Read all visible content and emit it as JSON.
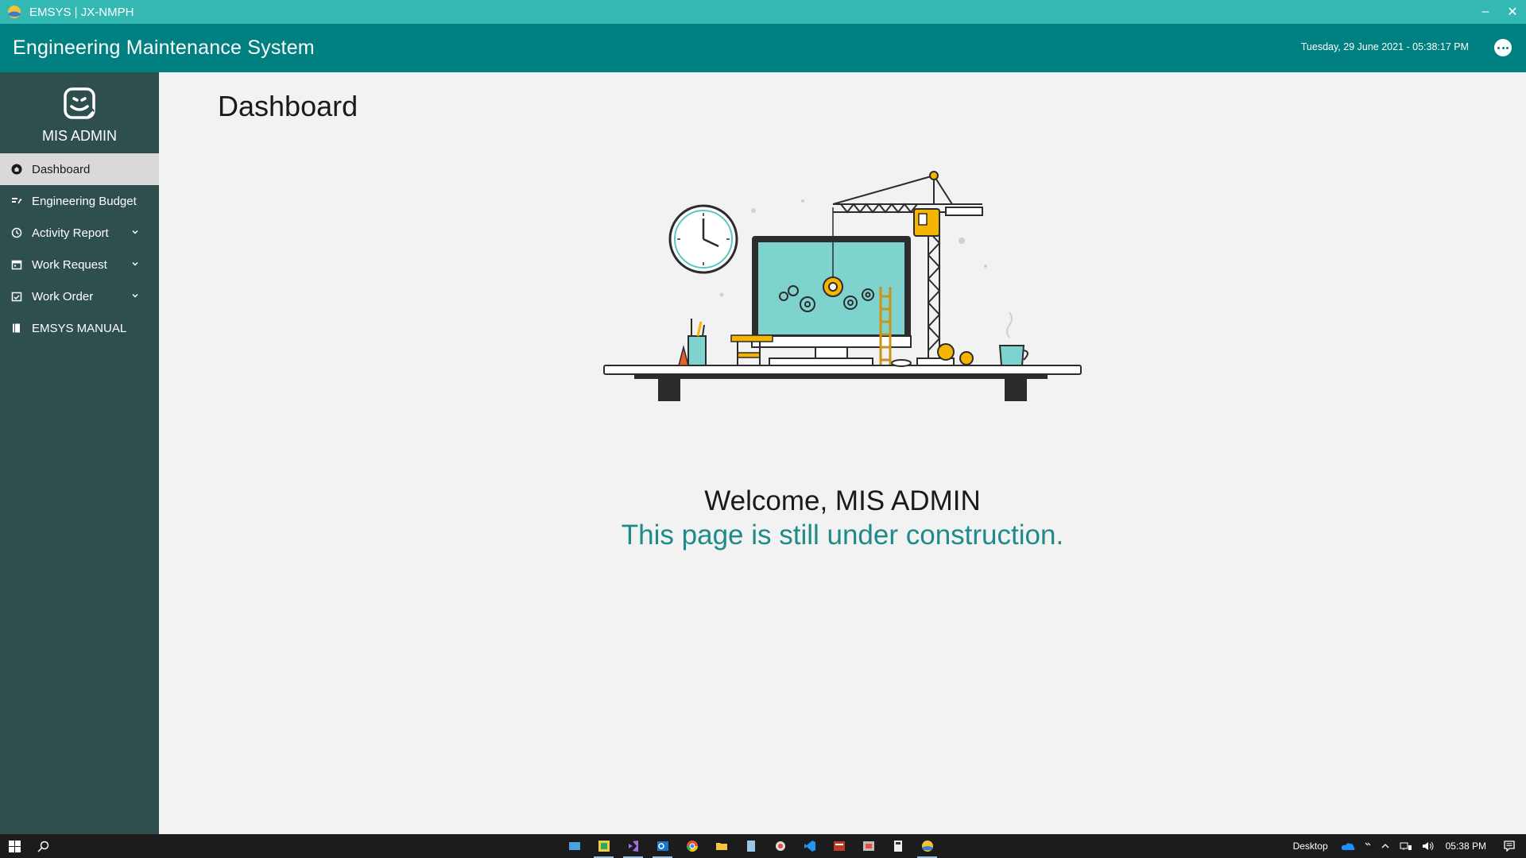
{
  "window": {
    "title": "EMSYS | JX-NMPH",
    "minimize_glyph": "–",
    "close_glyph": "✕"
  },
  "header": {
    "app_name": "Engineering Maintenance System",
    "datetime": "Tuesday, 29 June 2021 - 05:38:17 PM",
    "more_icon": "more-horizontal-icon"
  },
  "sidebar": {
    "username": "MIS ADMIN",
    "items": [
      {
        "label": "Dashboard",
        "icon": "home-icon",
        "active": true,
        "expandable": false
      },
      {
        "label": "Engineering Budget",
        "icon": "budget-icon",
        "active": false,
        "expandable": false
      },
      {
        "label": "Activity Report",
        "icon": "clock-icon",
        "active": false,
        "expandable": true
      },
      {
        "label": "Work Request",
        "icon": "calendar-icon",
        "active": false,
        "expandable": true
      },
      {
        "label": "Work Order",
        "icon": "checklist-icon",
        "active": false,
        "expandable": true
      },
      {
        "label": "EMSYS MANUAL",
        "icon": "book-icon",
        "active": false,
        "expandable": false
      }
    ]
  },
  "main": {
    "page_title": "Dashboard",
    "welcome": "Welcome, MIS ADMIN",
    "notice": "This page is still under construction."
  },
  "taskbar": {
    "desktop_label": "Desktop",
    "time": "05:38 PM",
    "apps": [
      "app-1-icon",
      "app-2-icon",
      "visual-studio-icon",
      "outlook-icon",
      "chrome-icon",
      "file-explorer-icon",
      "notepad-icon",
      "app-8-icon",
      "vscode-icon",
      "app-10-icon",
      "app-11-icon",
      "calculator-icon",
      "emsys-icon"
    ]
  },
  "colors": {
    "titlebar": "#34b8b4",
    "header": "#008080",
    "sidebar": "#2f4f4f",
    "notice_text": "#1f8a8a"
  }
}
